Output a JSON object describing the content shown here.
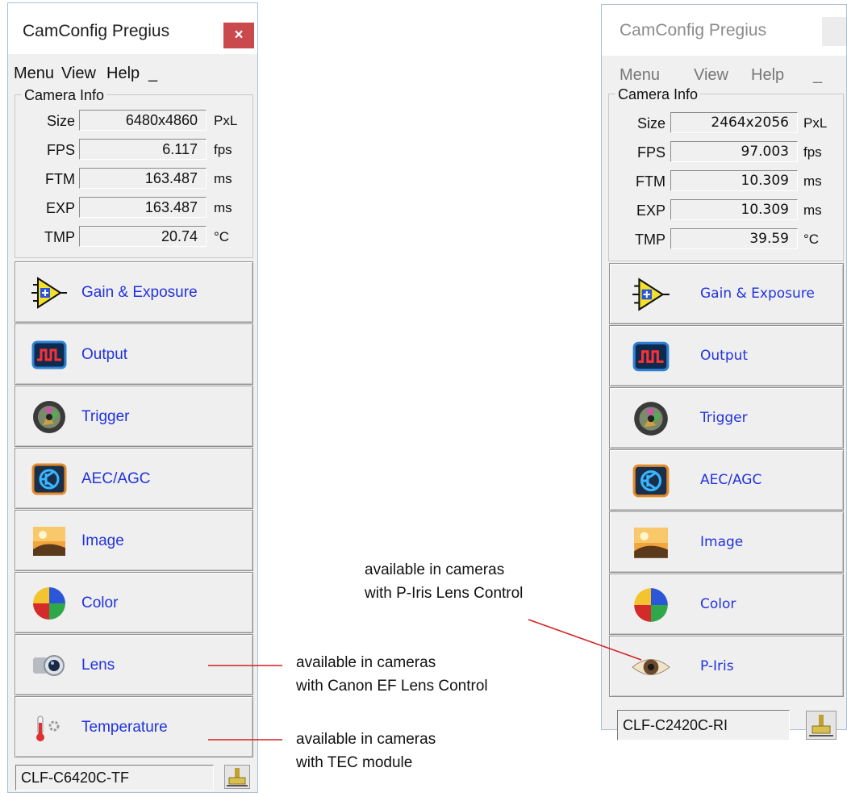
{
  "left_window": {
    "title": "CamConfig Pregius",
    "close_symbol": "×",
    "menu": [
      "Menu",
      "View",
      "Help",
      "_"
    ],
    "camera_info": {
      "heading": "Camera Info",
      "rows": [
        {
          "label": "Size",
          "value": "6480x4860",
          "unit": "PxL"
        },
        {
          "label": "FPS",
          "value": "6.117",
          "unit": "fps"
        },
        {
          "label": "FTM",
          "value": "163.487",
          "unit": "ms"
        },
        {
          "label": "EXP",
          "value": "163.487",
          "unit": "ms"
        },
        {
          "label": "TMP",
          "value": "20.74",
          "unit": "°C"
        }
      ]
    },
    "buttons": [
      {
        "label": "Gain & Exposure",
        "icon": "amplifier-icon"
      },
      {
        "label": "Output",
        "icon": "pulse-wave-icon"
      },
      {
        "label": "Trigger",
        "icon": "camera-shutter-icon"
      },
      {
        "label": "AEC/AGC",
        "icon": "transistor-icon"
      },
      {
        "label": "Image",
        "icon": "landscape-image-icon"
      },
      {
        "label": "Color",
        "icon": "color-wheel-icon"
      },
      {
        "label": "Lens",
        "icon": "lens-icon"
      },
      {
        "label": "Temperature",
        "icon": "thermometer-icon"
      }
    ],
    "status": "CLF-C6420C-TF"
  },
  "right_window": {
    "title": "CamConfig Pregius",
    "close_symbol": "×",
    "menu": [
      "Menu",
      "View",
      "Help",
      "_"
    ],
    "camera_info": {
      "heading": "Camera Info",
      "rows": [
        {
          "label": "Size",
          "value": "2464x2056",
          "unit": "PxL"
        },
        {
          "label": "FPS",
          "value": "97.003",
          "unit": "fps"
        },
        {
          "label": "FTM",
          "value": "10.309",
          "unit": "ms"
        },
        {
          "label": "EXP",
          "value": "10.309",
          "unit": "ms"
        },
        {
          "label": "TMP",
          "value": "39.59",
          "unit": "°C"
        }
      ]
    },
    "buttons": [
      {
        "label": "Gain & Exposure",
        "icon": "amplifier-icon"
      },
      {
        "label": "Output",
        "icon": "pulse-wave-icon"
      },
      {
        "label": "Trigger",
        "icon": "camera-shutter-icon"
      },
      {
        "label": "AEC/AGC",
        "icon": "transistor-icon"
      },
      {
        "label": "Image",
        "icon": "landscape-image-icon"
      },
      {
        "label": "Color",
        "icon": "color-wheel-icon"
      },
      {
        "label": "P-Iris",
        "icon": "eye-icon"
      }
    ],
    "status": "CLF-C2420C-RI"
  },
  "annotations": {
    "piris": [
      "available in cameras",
      "with P-Iris Lens Control"
    ],
    "lens": [
      "available in cameras",
      "with Canon EF Lens Control"
    ],
    "tec": [
      "available in cameras",
      "with TEC module"
    ],
    "line_color": "#d42020"
  }
}
